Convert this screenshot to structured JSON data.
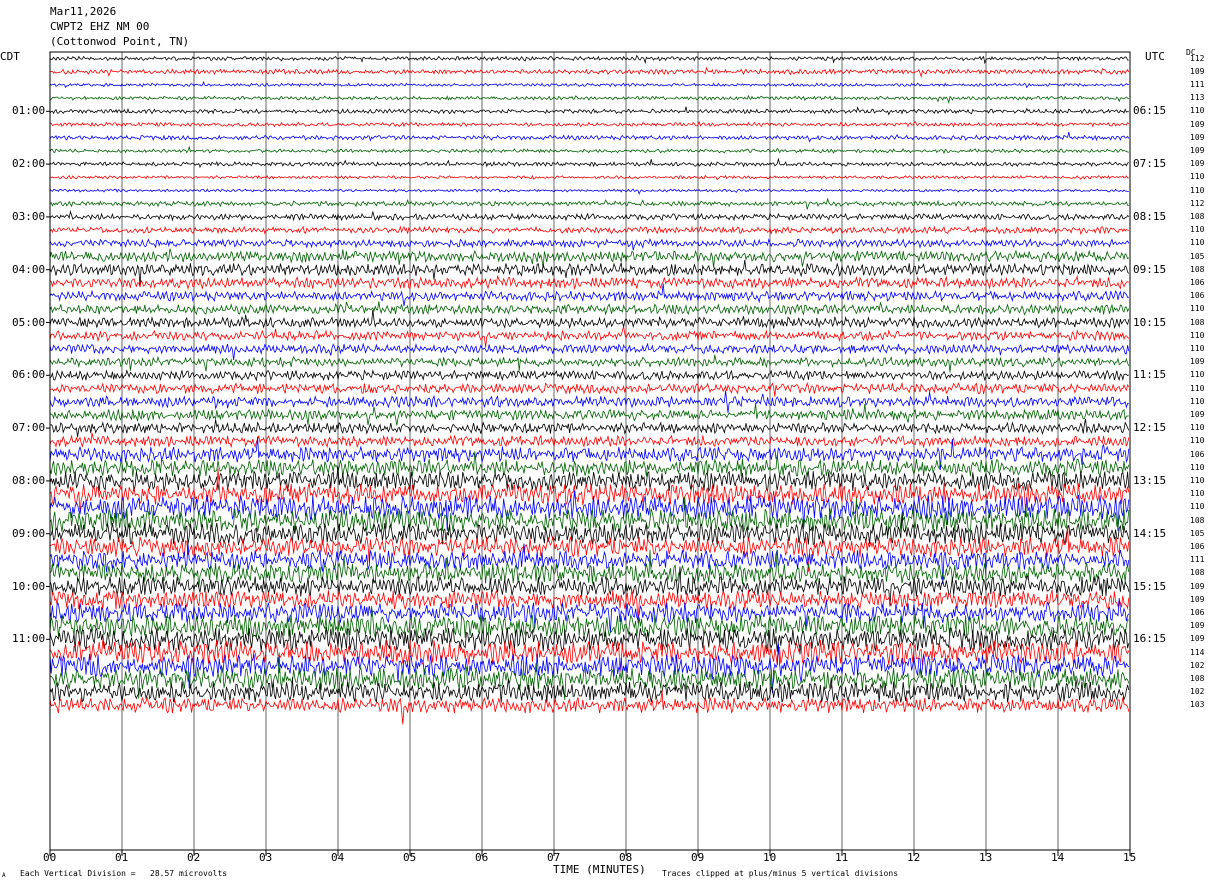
{
  "header": {
    "date": "Mar11,2026",
    "station": "CWPT2 EHZ NM 00",
    "location": "(Cottonwod Point, TN)"
  },
  "left_tz": "CDT",
  "right_tz": "UTC",
  "dc_label": "DC",
  "footer": {
    "scale_note": "Each Vertical Division =   28.57 microvolts",
    "clip_note": "Traces clipped at plus/minus 5 vertical divisions",
    "corner_mark": "A"
  },
  "colors": {
    "trace_cycle": [
      "#000000",
      "#ff0000",
      "#0000ff",
      "#006400"
    ],
    "grid": "#000000"
  },
  "chart_data": {
    "type": "line",
    "title": "CWPT2 EHZ NM 00",
    "xlabel": "TIME (MINUTES)",
    "xlim": [
      0,
      15
    ],
    "x_ticks": [
      "00",
      "01",
      "02",
      "03",
      "04",
      "05",
      "06",
      "07",
      "08",
      "09",
      "10",
      "11",
      "12",
      "13",
      "14",
      "15"
    ],
    "left_hour_labels": [
      "01:00",
      "02:00",
      "03:00",
      "04:00",
      "05:00",
      "06:00",
      "07:00",
      "08:00",
      "09:00",
      "10:00",
      "11:00"
    ],
    "right_hour_labels": [
      "06:15",
      "07:15",
      "08:15",
      "09:15",
      "10:15",
      "11:15",
      "12:15",
      "13:15",
      "14:15",
      "15:15",
      "16:15"
    ],
    "dc_offsets": [
      112,
      109,
      111,
      113,
      110,
      109,
      109,
      109,
      109,
      110,
      110,
      112,
      108,
      110,
      110,
      105,
      108,
      106,
      106,
      110,
      108,
      110,
      110,
      109,
      110,
      110,
      110,
      109,
      110,
      110,
      106,
      110,
      110,
      110,
      110,
      108,
      105,
      106,
      111,
      108,
      109,
      109,
      106,
      109,
      109,
      114,
      102,
      108,
      102,
      103
    ],
    "traces_per_hour": 4,
    "minutes_per_trace": 15,
    "noise_levels": [
      1.3,
      1.6,
      1.0,
      1.2,
      1.4,
      1.3,
      1.5,
      1.2,
      1.4,
      1.0,
      0.9,
      1.6,
      2.0,
      2.2,
      2.6,
      3.6,
      4.0,
      3.6,
      3.2,
      3.3,
      3.4,
      3.2,
      3.1,
      3.0,
      3.1,
      3.4,
      3.6,
      3.5,
      3.5,
      3.6,
      5.0,
      5.6,
      6.5,
      7.0,
      7.8,
      7.6,
      7.0,
      6.5,
      6.4,
      6.8,
      6.6,
      6.2,
      6.6,
      7.4,
      7.8,
      7.9,
      7.6,
      7.4,
      6.8,
      5.0
    ]
  }
}
